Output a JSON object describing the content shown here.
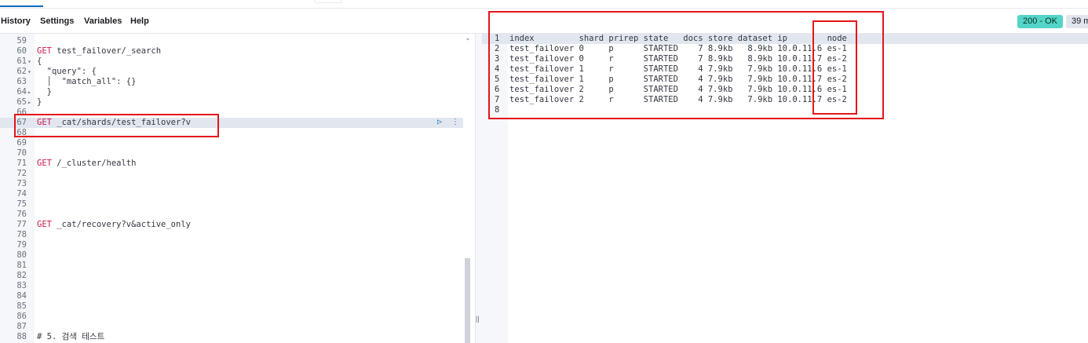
{
  "menu": {
    "history": "History",
    "settings": "Settings",
    "variables": "Variables",
    "help": "Help"
  },
  "status": {
    "code": "200 - OK",
    "time": "39 m"
  },
  "request_editor": {
    "lines": [
      {
        "num": "59",
        "code": ""
      },
      {
        "num": "60",
        "method": "GET",
        "code": " test_failover/_search"
      },
      {
        "num": "61",
        "fold": "▾",
        "code": "{"
      },
      {
        "num": "62",
        "fold": "▾",
        "code": "  \"query\": {"
      },
      {
        "num": "63",
        "code": "  │  \"match_all\": {}"
      },
      {
        "num": "64",
        "fold": "▸",
        "code": "  }"
      },
      {
        "num": "65",
        "fold": "▸",
        "code": "}"
      },
      {
        "num": "66",
        "code": ""
      },
      {
        "num": "67",
        "method": "GET",
        "code": " _cat/shards/test_failover?v",
        "active": true
      },
      {
        "num": "68",
        "code": ""
      },
      {
        "num": "69",
        "code": ""
      },
      {
        "num": "70",
        "code": ""
      },
      {
        "num": "71",
        "method": "GET",
        "code": " /_cluster/health"
      },
      {
        "num": "72",
        "code": ""
      },
      {
        "num": "73",
        "code": ""
      },
      {
        "num": "74",
        "code": ""
      },
      {
        "num": "75",
        "code": ""
      },
      {
        "num": "76",
        "code": ""
      },
      {
        "num": "77",
        "method": "GET",
        "code": " _cat/recovery?v&active_only"
      },
      {
        "num": "78",
        "code": ""
      },
      {
        "num": "79",
        "code": ""
      },
      {
        "num": "80",
        "code": ""
      },
      {
        "num": "81",
        "code": ""
      },
      {
        "num": "82",
        "code": ""
      },
      {
        "num": "83",
        "code": ""
      },
      {
        "num": "84",
        "code": ""
      },
      {
        "num": "85",
        "code": ""
      },
      {
        "num": "86",
        "code": ""
      },
      {
        "num": "87",
        "code": ""
      },
      {
        "num": "88",
        "code": "# 5. 검색 테스트"
      }
    ]
  },
  "response_editor": {
    "lines": [
      {
        "num": "1",
        "code": "index         shard prirep state   docs store dataset ip        node"
      },
      {
        "num": "2",
        "code": "test_failover 0     p      STARTED    7 8.9kb   8.9kb 10.0.11.6 es-1"
      },
      {
        "num": "3",
        "code": "test_failover 0     r      STARTED    7 8.9kb   8.9kb 10.0.11.7 es-2"
      },
      {
        "num": "4",
        "code": "test_failover 1     r      STARTED    4 7.9kb   7.9kb 10.0.11.6 es-1"
      },
      {
        "num": "5",
        "code": "test_failover 1     p      STARTED    4 7.9kb   7.9kb 10.0.11.7 es-2"
      },
      {
        "num": "6",
        "code": "test_failover 2     p      STARTED    4 7.9kb   7.9kb 10.0.11.6 es-1"
      },
      {
        "num": "7",
        "code": "test_failover 2     r      STARTED    4 7.9kb   7.9kb 10.0.11.7 es-2"
      },
      {
        "num": "8",
        "code": ""
      }
    ]
  },
  "icons": {
    "run": "▷",
    "wrench": "⋮",
    "splitter": "||",
    "collapse": "◂"
  },
  "colors": {
    "highlight": "#e5141b",
    "status_ok": "#54d4c8",
    "method": "#c9184a"
  }
}
